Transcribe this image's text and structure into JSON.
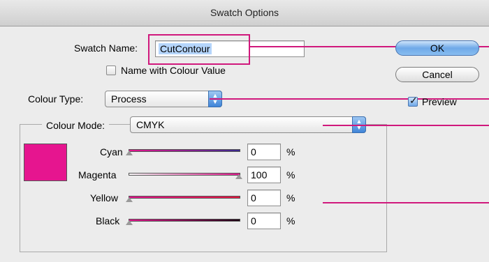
{
  "window": {
    "title": "Swatch Options"
  },
  "swatch_name": {
    "label": "Swatch Name:",
    "value": "CutContour"
  },
  "name_with_colour_value": {
    "label": "Name with Colour Value",
    "checked": false
  },
  "colour_type": {
    "label": "Colour Type:",
    "value": "Process"
  },
  "colour_mode": {
    "label": "Colour Mode:",
    "value": "CMYK"
  },
  "buttons": {
    "ok": "OK",
    "cancel": "Cancel"
  },
  "preview": {
    "label": "Preview",
    "checked": true
  },
  "channels": [
    {
      "label": "Cyan",
      "value": "0",
      "unit": "%"
    },
    {
      "label": "Magenta",
      "value": "100",
      "unit": "%"
    },
    {
      "label": "Yellow",
      "value": "0",
      "unit": "%"
    },
    {
      "label": "Black",
      "value": "0",
      "unit": "%"
    }
  ],
  "colors": {
    "swatch": "#e6158f",
    "callout": "#d0187c"
  }
}
